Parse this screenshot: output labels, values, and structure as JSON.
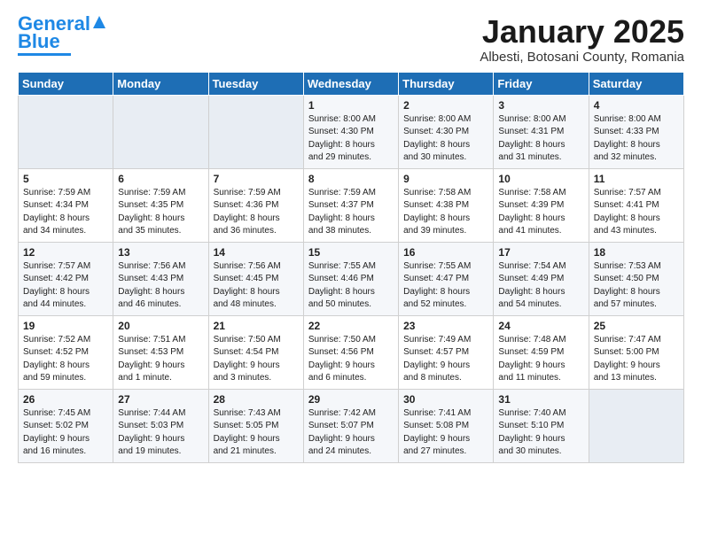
{
  "logo": {
    "line1": "General",
    "line2": "Blue"
  },
  "title": "January 2025",
  "subtitle": "Albesti, Botosani County, Romania",
  "weekdays": [
    "Sunday",
    "Monday",
    "Tuesday",
    "Wednesday",
    "Thursday",
    "Friday",
    "Saturday"
  ],
  "weeks": [
    [
      {
        "day": "",
        "info": ""
      },
      {
        "day": "",
        "info": ""
      },
      {
        "day": "",
        "info": ""
      },
      {
        "day": "1",
        "info": "Sunrise: 8:00 AM\nSunset: 4:30 PM\nDaylight: 8 hours\nand 29 minutes."
      },
      {
        "day": "2",
        "info": "Sunrise: 8:00 AM\nSunset: 4:30 PM\nDaylight: 8 hours\nand 30 minutes."
      },
      {
        "day": "3",
        "info": "Sunrise: 8:00 AM\nSunset: 4:31 PM\nDaylight: 8 hours\nand 31 minutes."
      },
      {
        "day": "4",
        "info": "Sunrise: 8:00 AM\nSunset: 4:33 PM\nDaylight: 8 hours\nand 32 minutes."
      }
    ],
    [
      {
        "day": "5",
        "info": "Sunrise: 7:59 AM\nSunset: 4:34 PM\nDaylight: 8 hours\nand 34 minutes."
      },
      {
        "day": "6",
        "info": "Sunrise: 7:59 AM\nSunset: 4:35 PM\nDaylight: 8 hours\nand 35 minutes."
      },
      {
        "day": "7",
        "info": "Sunrise: 7:59 AM\nSunset: 4:36 PM\nDaylight: 8 hours\nand 36 minutes."
      },
      {
        "day": "8",
        "info": "Sunrise: 7:59 AM\nSunset: 4:37 PM\nDaylight: 8 hours\nand 38 minutes."
      },
      {
        "day": "9",
        "info": "Sunrise: 7:58 AM\nSunset: 4:38 PM\nDaylight: 8 hours\nand 39 minutes."
      },
      {
        "day": "10",
        "info": "Sunrise: 7:58 AM\nSunset: 4:39 PM\nDaylight: 8 hours\nand 41 minutes."
      },
      {
        "day": "11",
        "info": "Sunrise: 7:57 AM\nSunset: 4:41 PM\nDaylight: 8 hours\nand 43 minutes."
      }
    ],
    [
      {
        "day": "12",
        "info": "Sunrise: 7:57 AM\nSunset: 4:42 PM\nDaylight: 8 hours\nand 44 minutes."
      },
      {
        "day": "13",
        "info": "Sunrise: 7:56 AM\nSunset: 4:43 PM\nDaylight: 8 hours\nand 46 minutes."
      },
      {
        "day": "14",
        "info": "Sunrise: 7:56 AM\nSunset: 4:45 PM\nDaylight: 8 hours\nand 48 minutes."
      },
      {
        "day": "15",
        "info": "Sunrise: 7:55 AM\nSunset: 4:46 PM\nDaylight: 8 hours\nand 50 minutes."
      },
      {
        "day": "16",
        "info": "Sunrise: 7:55 AM\nSunset: 4:47 PM\nDaylight: 8 hours\nand 52 minutes."
      },
      {
        "day": "17",
        "info": "Sunrise: 7:54 AM\nSunset: 4:49 PM\nDaylight: 8 hours\nand 54 minutes."
      },
      {
        "day": "18",
        "info": "Sunrise: 7:53 AM\nSunset: 4:50 PM\nDaylight: 8 hours\nand 57 minutes."
      }
    ],
    [
      {
        "day": "19",
        "info": "Sunrise: 7:52 AM\nSunset: 4:52 PM\nDaylight: 8 hours\nand 59 minutes."
      },
      {
        "day": "20",
        "info": "Sunrise: 7:51 AM\nSunset: 4:53 PM\nDaylight: 9 hours\nand 1 minute."
      },
      {
        "day": "21",
        "info": "Sunrise: 7:50 AM\nSunset: 4:54 PM\nDaylight: 9 hours\nand 3 minutes."
      },
      {
        "day": "22",
        "info": "Sunrise: 7:50 AM\nSunset: 4:56 PM\nDaylight: 9 hours\nand 6 minutes."
      },
      {
        "day": "23",
        "info": "Sunrise: 7:49 AM\nSunset: 4:57 PM\nDaylight: 9 hours\nand 8 minutes."
      },
      {
        "day": "24",
        "info": "Sunrise: 7:48 AM\nSunset: 4:59 PM\nDaylight: 9 hours\nand 11 minutes."
      },
      {
        "day": "25",
        "info": "Sunrise: 7:47 AM\nSunset: 5:00 PM\nDaylight: 9 hours\nand 13 minutes."
      }
    ],
    [
      {
        "day": "26",
        "info": "Sunrise: 7:45 AM\nSunset: 5:02 PM\nDaylight: 9 hours\nand 16 minutes."
      },
      {
        "day": "27",
        "info": "Sunrise: 7:44 AM\nSunset: 5:03 PM\nDaylight: 9 hours\nand 19 minutes."
      },
      {
        "day": "28",
        "info": "Sunrise: 7:43 AM\nSunset: 5:05 PM\nDaylight: 9 hours\nand 21 minutes."
      },
      {
        "day": "29",
        "info": "Sunrise: 7:42 AM\nSunset: 5:07 PM\nDaylight: 9 hours\nand 24 minutes."
      },
      {
        "day": "30",
        "info": "Sunrise: 7:41 AM\nSunset: 5:08 PM\nDaylight: 9 hours\nand 27 minutes."
      },
      {
        "day": "31",
        "info": "Sunrise: 7:40 AM\nSunset: 5:10 PM\nDaylight: 9 hours\nand 30 minutes."
      },
      {
        "day": "",
        "info": ""
      }
    ]
  ]
}
